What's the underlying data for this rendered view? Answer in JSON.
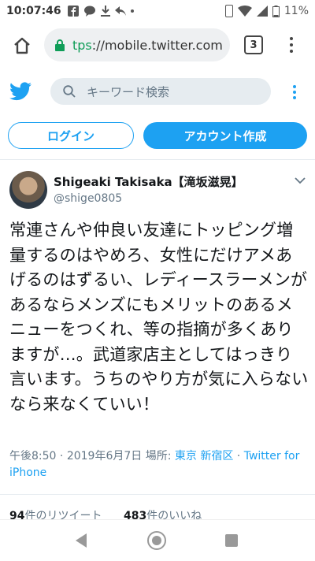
{
  "status_bar": {
    "time": "10:07:46",
    "battery": "11%"
  },
  "browser": {
    "url_scheme": "tps",
    "url_rest": "://mobile.twitter.com",
    "tab_count": "3"
  },
  "twitter_header": {
    "search_placeholder": "キーワード検索"
  },
  "auth": {
    "login_label": "ログイン",
    "signup_label": "アカウント作成"
  },
  "tweet": {
    "author_name": "Shigeaki Takisaka【滝坂滋晃】",
    "author_handle": "@shige0805",
    "text": "常連さんや仲良い友達にトッピング増量するのはやめろ、女性にだけアメあげるのはずるい、レディースラーメンがあるならメンズにもメリットのあるメニューをつくれ、等の指摘が多くありますが…。武道家店主としてはっきり言います。うちのやり方が気に入らないなら来なくていい！",
    "time": "午後8:50",
    "date": "2019年6月7日",
    "place_label": "場所:",
    "place": "東京 新宿区",
    "source": "Twitter for iPhone",
    "retweet_count": "94",
    "retweet_label": "件のリツイート",
    "like_count": "483",
    "like_label": "件のいいね"
  },
  "colors": {
    "twitter_blue": "#1da1f2",
    "text_gray": "#657786"
  }
}
